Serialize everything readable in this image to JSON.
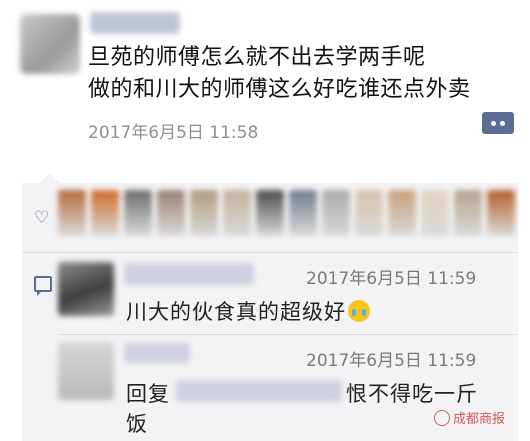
{
  "post": {
    "text_line1": "旦苑的师傅怎么就不出去学两手呢",
    "text_line2": "做的和川大的师傅这么好吃谁还点外卖",
    "timestamp": "2017年6月5日 11:58"
  },
  "likes": {
    "avatar_colors": [
      "#b56a3a",
      "#d06a2a",
      "#6c6c6c",
      "#9a8070",
      "#b09a7a",
      "#c4b09a",
      "#4a4a4a",
      "#6f7c8a",
      "#aaaaaa",
      "#d8c2aa",
      "#c9a07a",
      "#e0d2c0",
      "#b6a48e",
      "#b55e28"
    ]
  },
  "comments": [
    {
      "timestamp": "2017年6月5日 11:59",
      "text": "川大的伙食真的超级好",
      "emoji": "crying-face-icon"
    },
    {
      "timestamp": "2017年6月5日 11:59",
      "reply_prefix": "回复",
      "text_after_name": "恨不得吃一斤",
      "text_line2": "饭"
    }
  ],
  "watermark": {
    "text": "成都商报"
  },
  "colors": {
    "accent": "#5c6d95",
    "panel_bg": "#f3f3f5",
    "time_text": "#8f8f8f"
  }
}
